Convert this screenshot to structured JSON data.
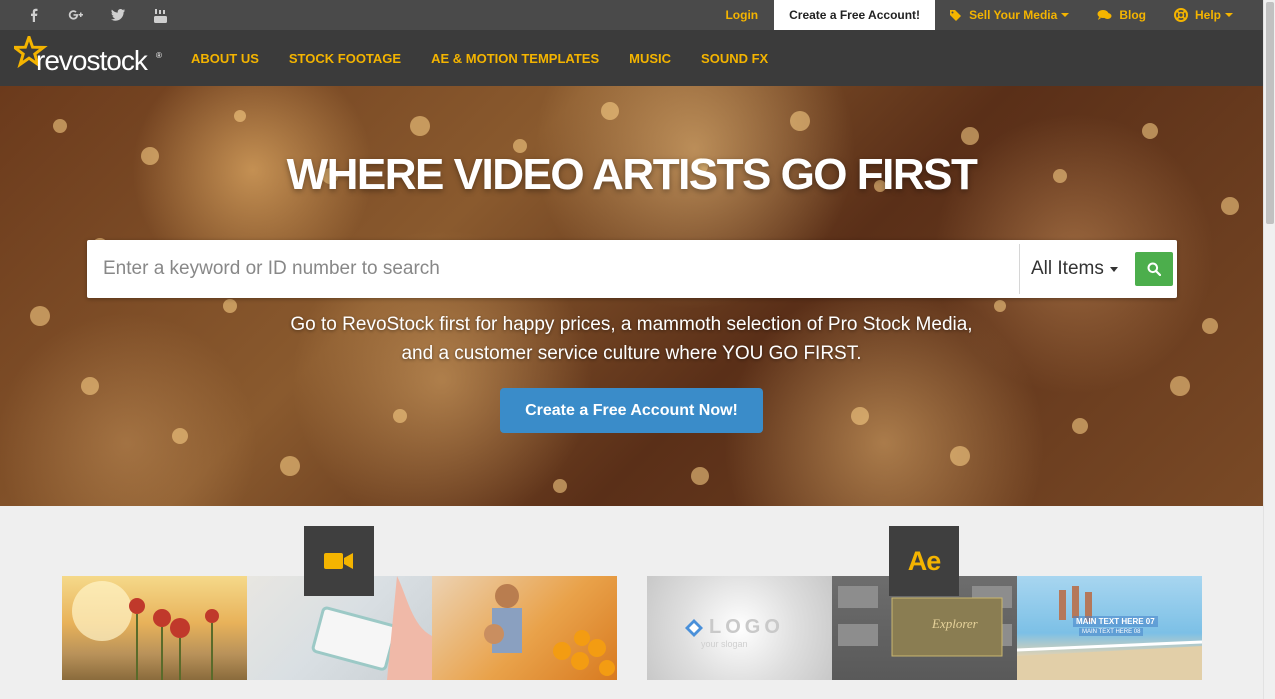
{
  "social": {
    "items": [
      "facebook-icon",
      "google-plus-icon",
      "twitter-icon",
      "youtube-icon"
    ]
  },
  "topnav": {
    "login": "Login",
    "create_account": "Create a Free Account!",
    "sell_media": "Sell Your Media",
    "blog": "Blog",
    "help": "Help"
  },
  "brand": {
    "name": "revostock",
    "reg": "®",
    "accent": "#f4b400"
  },
  "mainnav": {
    "items": [
      "ABOUT US",
      "STOCK FOOTAGE",
      "AE & MOTION TEMPLATES",
      "MUSIC",
      "SOUND FX"
    ]
  },
  "hero": {
    "title": "WHERE VIDEO ARTISTS GO FIRST",
    "search_placeholder": "Enter a keyword or ID number to search",
    "category_selected": "All Items",
    "subtitle_line1": "Go to RevoStock first for happy prices, a mammoth selection of Pro Stock Media,",
    "subtitle_line2": "and a customer service culture where YOU GO FIRST.",
    "cta_label": "Create a Free Account Now!"
  },
  "cards": {
    "ae_badge": "Ae",
    "logo_thumb_text": "LOGO",
    "logo_thumb_slogan": "your slogan",
    "explorer_thumb_text": "Explorer",
    "beach_thumb_text": "MAIN TEXT HERE 07",
    "beach_thumb_subtext": "MAIN TEXT HERE 08"
  },
  "colors": {
    "topbar": "#4a4a4a",
    "mainnav": "#3b3b3b",
    "cta": "#3a8cc9",
    "search_button": "#4cae4c"
  }
}
